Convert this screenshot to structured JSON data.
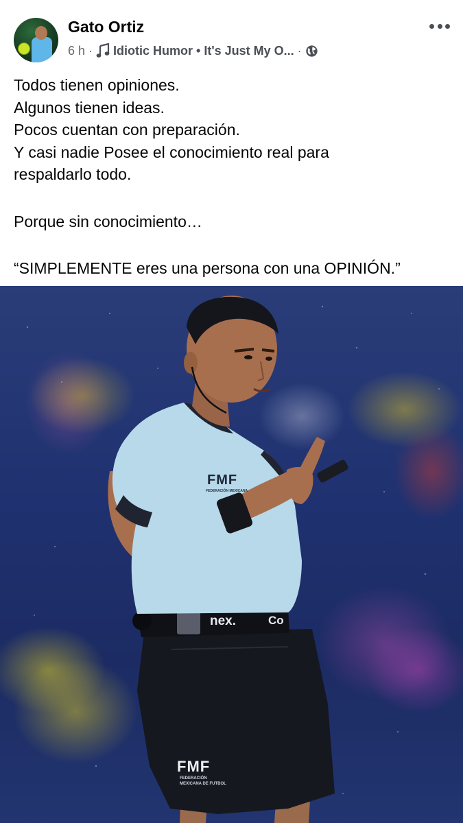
{
  "post": {
    "author": {
      "name": "Gato Ortiz"
    },
    "meta": {
      "time": "6 h",
      "separator": "·",
      "music_icon": "music-note-icon",
      "group_text": "Idiotic Humor • It's Just My O...",
      "privacy_icon": "globe-icon"
    },
    "more_icon": "more-horizontal-icon",
    "caption": {
      "lines": [
        "Todos tienen opiniones.",
        "Algunos tienen ideas.",
        "Pocos cuentan con preparación.",
        "Y casi nadie Posee el conocimiento real para",
        "respaldarlo todo.",
        "Porque sin conocimiento…",
        "“SIMPLEMENTE eres una persona con una OPINIÓN.”"
      ]
    },
    "photo": {
      "shirt_logo": "FMF",
      "shirt_logo_sub": "FEDERACIÓN MEXICANA",
      "belt_text_1": "nex.",
      "belt_text_2": "Co",
      "shorts_logo": "FMF",
      "shorts_logo_sub": "FEDERACIÓN MEXICANA DE FUTBOL"
    }
  },
  "colors": {
    "text_primary": "#050505",
    "text_secondary": "#65676b",
    "shirt": "#b7d9ea",
    "shorts": "#16181f",
    "stadium_bg": "#1f3170"
  }
}
